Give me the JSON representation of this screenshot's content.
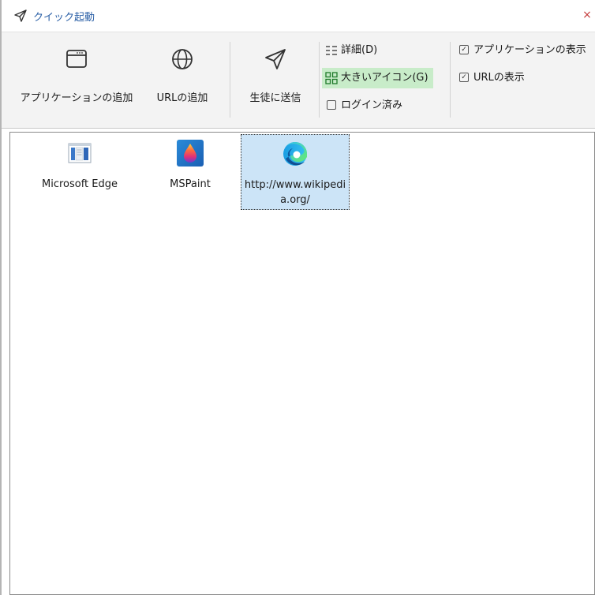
{
  "window": {
    "title": "クイック起動",
    "close_glyph": "×"
  },
  "ribbon": {
    "add_app_label": "アプリケーションの追加",
    "add_url_label": "URLの追加",
    "send_label": "生徒に送信",
    "view_details_label": "詳細(D)",
    "view_large_icons_label": "大きいアイコン(G)",
    "logged_in_label": "ログイン済み",
    "show_apps_label": "アプリケーションの表示",
    "show_urls_label": "URLの表示",
    "show_apps_checked": true,
    "show_urls_checked": true,
    "logged_in_checked": false,
    "active_view": "large_icons"
  },
  "items": [
    {
      "label": "Microsoft Edge",
      "icon": "edge-legacy-app-icon",
      "selected": false
    },
    {
      "label": "MSPaint",
      "icon": "paint-drop-icon",
      "selected": false
    },
    {
      "label": "http://www.wikipedia.org/",
      "icon": "edge-icon",
      "selected": true
    }
  ],
  "colors": {
    "title_text": "#2a5fa6",
    "active_view_bg": "#c8ecc9",
    "selection_bg": "#cce4f7",
    "close_red": "#c43b3b"
  }
}
